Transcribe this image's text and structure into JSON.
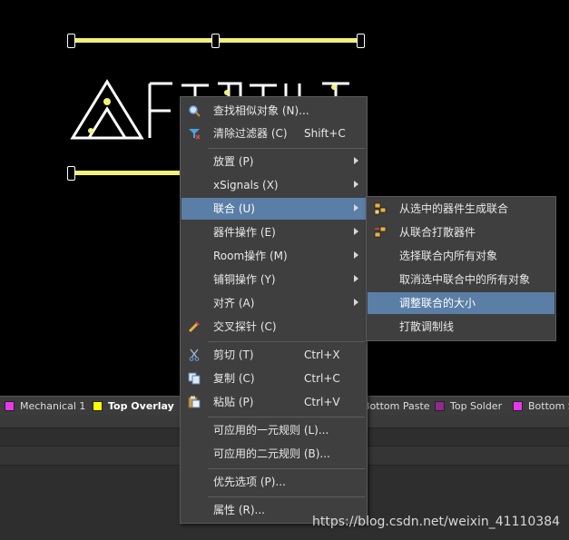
{
  "layers": [
    {
      "name": "Mechanical 1",
      "color": "#e838e8"
    },
    {
      "name": "Top Overlay",
      "color": "#ffff00",
      "active": true
    },
    {
      "name": "Bottom Paste",
      "color": "#808080"
    },
    {
      "name": "Top Solder",
      "color": "#8f2a8f"
    },
    {
      "name": "Bottom S",
      "color": "#e838e8"
    }
  ],
  "menu": {
    "items": [
      {
        "label": "查找相似对象 (N)...",
        "icon": "search-icon"
      },
      {
        "label": "清除过滤器 (C)",
        "shortcut": "Shift+C",
        "icon": "clear-filter-icon"
      },
      {
        "label": "放置 (P)",
        "submenu": true
      },
      {
        "label": "xSignals (X)",
        "submenu": true
      },
      {
        "label": "联合 (U)",
        "submenu": true,
        "highlighted": true
      },
      {
        "label": "器件操作 (E)",
        "submenu": true
      },
      {
        "label": "Room操作 (M)",
        "submenu": true
      },
      {
        "label": "铺铜操作 (Y)",
        "submenu": true
      },
      {
        "label": "对齐 (A)",
        "submenu": true
      },
      {
        "label": "交叉探针 (C)",
        "icon": "cross-probe-icon"
      },
      {
        "label": "剪切 (T)",
        "shortcut": "Ctrl+X",
        "icon": "scissors-icon"
      },
      {
        "label": "复制 (C)",
        "shortcut": "Ctrl+C",
        "icon": "copy-icon"
      },
      {
        "label": "粘贴 (P)",
        "shortcut": "Ctrl+V",
        "icon": "paste-icon"
      },
      {
        "label": "可应用的一元规则 (L)..."
      },
      {
        "label": "可应用的二元规则 (B)..."
      },
      {
        "label": "优先选项 (P)..."
      },
      {
        "label": "属性 (R)..."
      }
    ]
  },
  "submenu": {
    "items": [
      {
        "label": "从选中的器件生成联合",
        "icon": "create-union-icon"
      },
      {
        "label": "从联合打散器件",
        "icon": "break-union-icon"
      },
      {
        "label": "选择联合内所有对象"
      },
      {
        "label": "取消选中联合中的所有对象"
      },
      {
        "label": "调整联合的大小",
        "highlighted": true
      },
      {
        "label": "打散调制线"
      }
    ]
  },
  "watermark": "https://blog.csdn.net/weixin_41110384"
}
